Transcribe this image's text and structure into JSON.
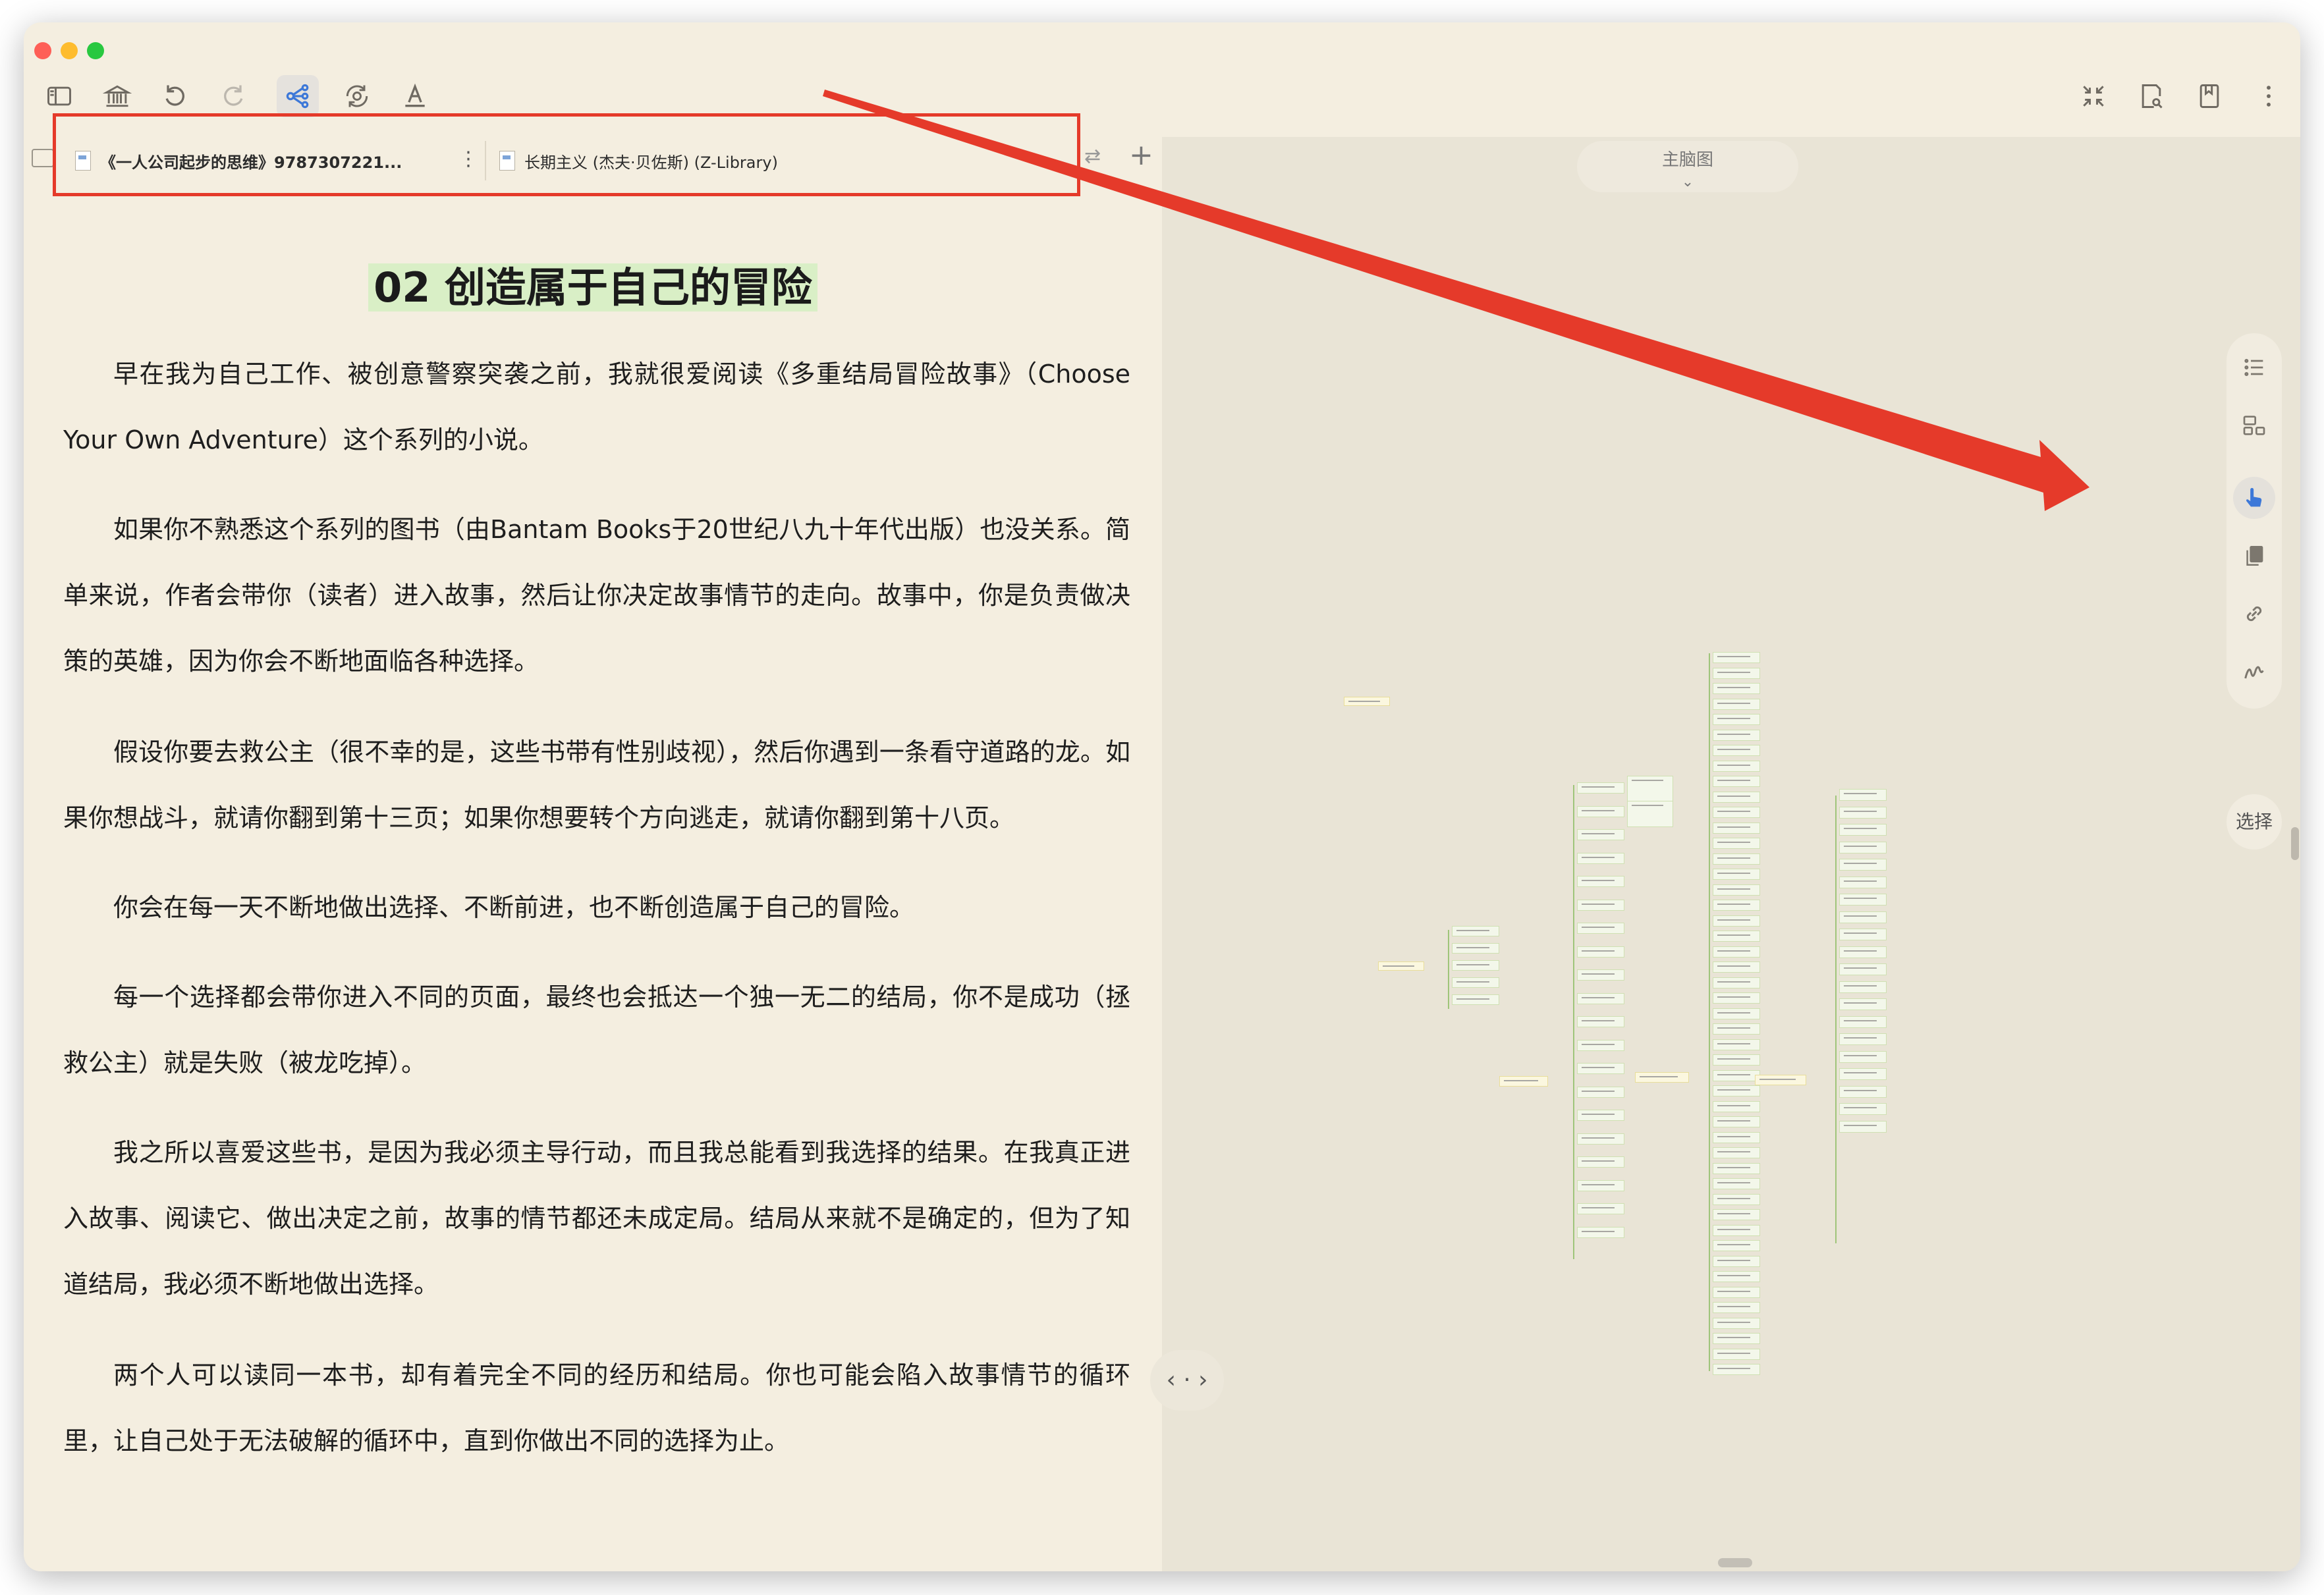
{
  "toolbar": {
    "left_icons": [
      "sidebar-icon",
      "library-icon",
      "undo-icon",
      "redo-icon",
      "mindmap-icon",
      "sync-icon",
      "font-icon"
    ],
    "right_icons": [
      "collapse-icon",
      "search-document-icon",
      "bookmark-icon",
      "more-icon"
    ]
  },
  "tabs": [
    {
      "label": "《一人公司起步的思维》9787307221...",
      "active": true
    },
    {
      "label": "长期主义 (杰夫·贝佐斯) (Z-Library)",
      "active": false
    }
  ],
  "tab_more": "⋮",
  "tab_add": "+",
  "tab_swap": "⇄",
  "reader": {
    "title": "02 创造属于自己的冒险",
    "paragraphs": [
      "早在我为自己工作、被创意警察突袭之前，我就很爱阅读《多重结局冒险故事》（Choose Your Own Adventure）这个系列的小说。",
      "如果你不熟悉这个系列的图书（由Bantam Books于20世纪八九十年代出版）也没关系。简单来说，作者会带你（读者）进入故事，然后让你决定故事情节的走向。故事中，你是负责做决策的英雄，因为你会不断地面临各种选择。",
      "假设你要去救公主（很不幸的是，这些书带有性别歧视），然后你遇到一条看守道路的龙。如果你想战斗，就请你翻到第十三页；如果你想要转个方向逃走，就请你翻到第十八页。",
      "你会在每一天不断地做出选择、不断前进，也不断创造属于自己的冒险。",
      "每一个选择都会带你进入不同的页面，最终也会抵达一个独一无二的结局，你不是成功（拯救公主）就是失败（被龙吃掉）。",
      "我之所以喜爱这些书，是因为我必须主导行动，而且我总能看到我选择的结果。在我真正进入故事、阅读它、做出决定之前，故事的情节都还未成定局。结局从来就不是确定的，但为了知道结局，我必须不断地做出选择。",
      "两个人可以读同一本书，却有着完全不同的经历和结局。你也可能会陷入故事情节的循环里，让自己处于无法破解的循环中，直到你做出不同的选择为止。"
    ],
    "nav_arrows": "‹ · ›"
  },
  "mindmap": {
    "selector_label": "主脑图",
    "select_label": "选择",
    "right_toolbar_icons": [
      "outline-icon",
      "layout-icon",
      "hand-pointer-icon",
      "copy-icon",
      "link-icon",
      "freehand-icon"
    ],
    "root_count": 2,
    "column_counts": [
      5,
      20,
      3,
      47,
      20
    ]
  },
  "colors": {
    "window_bg": "#f4eee0",
    "map_bg": "#e9e4d6",
    "title_highlight": "#d9efc6",
    "annotation_red": "#e53a2a",
    "accent_blue": "#3d78d8"
  }
}
